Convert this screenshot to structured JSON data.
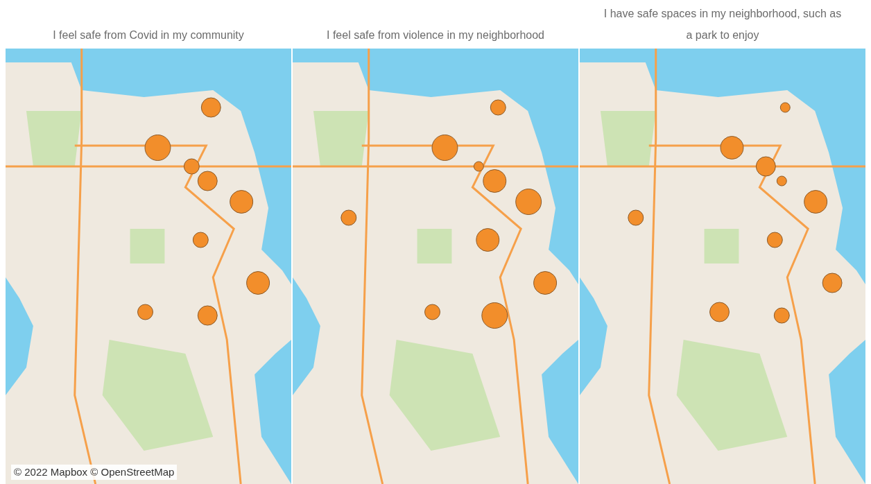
{
  "maps": [
    {
      "title": "I feel safe from Covid in my community",
      "markers": [
        {
          "kind": "medium"
        },
        {
          "kind": "huge"
        },
        {
          "kind": "small"
        },
        {
          "kind": "medium"
        },
        {
          "kind": "large"
        },
        {
          "kind": "small"
        },
        {
          "kind": "large"
        },
        {
          "kind": "small"
        },
        {
          "kind": "medium"
        }
      ]
    },
    {
      "title": "I feel safe from violence in my neighborhood",
      "markers": [
        {
          "kind": "small"
        },
        {
          "kind": "huge"
        },
        {
          "kind": "tiny"
        },
        {
          "kind": "large"
        },
        {
          "kind": "huge"
        },
        {
          "kind": "large"
        },
        {
          "kind": "large"
        },
        {
          "kind": "small"
        },
        {
          "kind": "huge"
        },
        {
          "kind": "small"
        }
      ]
    },
    {
      "title": "I have safe spaces in my neighborhood, such as a park to enjoy",
      "markers": [
        {
          "kind": "tiny"
        },
        {
          "kind": "large"
        },
        {
          "kind": "medium"
        },
        {
          "kind": "tiny"
        },
        {
          "kind": "large"
        },
        {
          "kind": "small"
        },
        {
          "kind": "medium"
        },
        {
          "kind": "medium"
        },
        {
          "kind": "small"
        },
        {
          "kind": "small"
        }
      ]
    }
  ],
  "attribution": "© 2022 Mapbox © OpenStreetMap"
}
